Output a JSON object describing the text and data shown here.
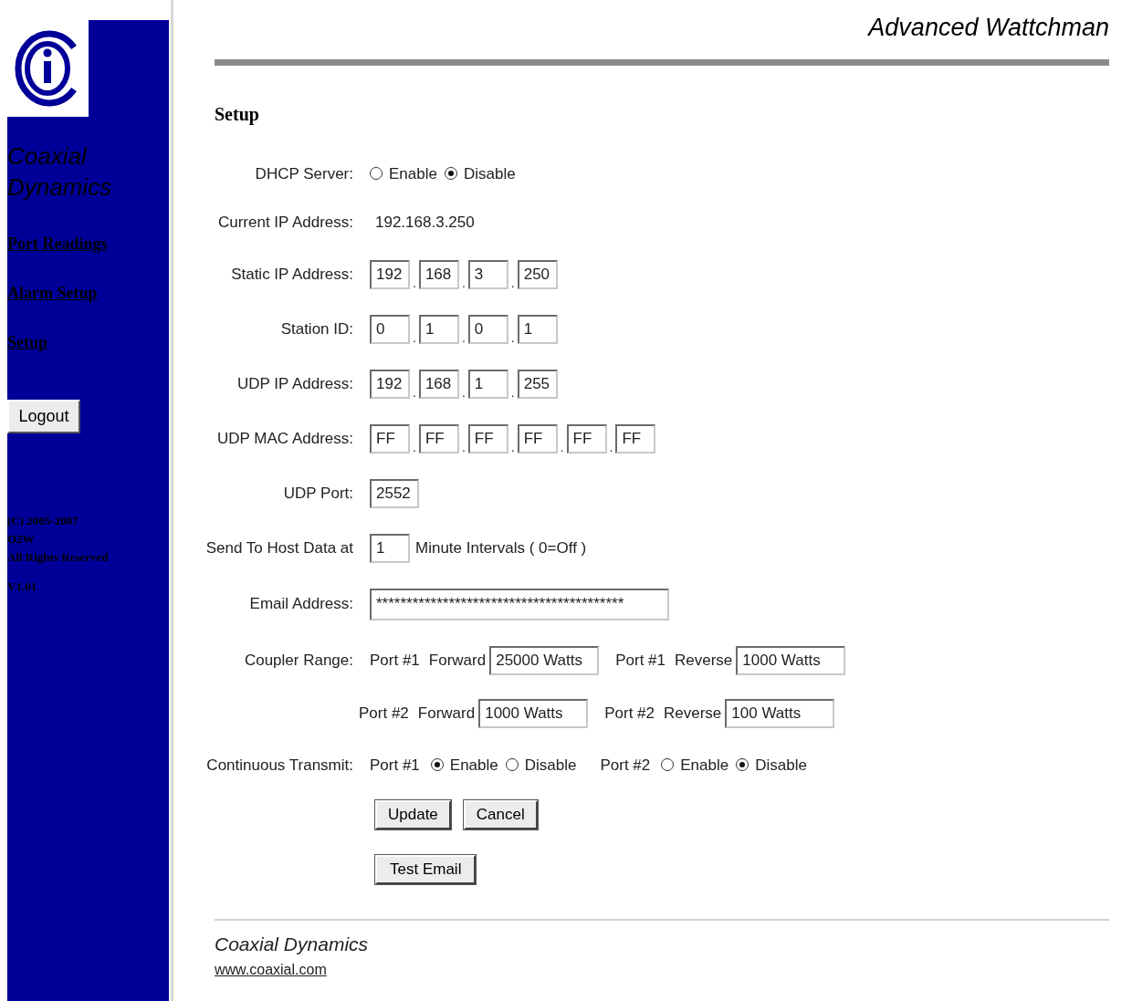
{
  "header": {
    "title": "Advanced Wattchman"
  },
  "sidebar": {
    "brand": "Coaxial Dynamics",
    "links": [
      "Port Readings",
      "Alarm Setup",
      "Setup"
    ],
    "logout": "Logout",
    "footer_lines": [
      "(C) 2005-2007",
      "O2W",
      "All Rights Reserved"
    ],
    "version": "V1.01"
  },
  "form": {
    "title": "Setup",
    "rows": [
      {
        "kind": "radio",
        "label": "DHCP Server:",
        "options": [
          {
            "label": "Enable",
            "selected": false
          },
          {
            "label": "Disable",
            "selected": true
          }
        ]
      },
      {
        "kind": "text",
        "label": "Current IP Address:",
        "value": "192.168.3.250"
      },
      {
        "kind": "octets",
        "label": "Static IP Address:",
        "separator": ".",
        "values": [
          "192",
          "168",
          "3",
          "250"
        ]
      },
      {
        "kind": "octets",
        "label": "Station ID:",
        "separator": ".",
        "values": [
          "0",
          "1",
          "0",
          "1"
        ]
      },
      {
        "kind": "octets",
        "label": "UDP IP Address:",
        "separator": ".",
        "values": [
          "192",
          "168",
          "1",
          "255"
        ]
      },
      {
        "kind": "octets",
        "label": "UDP MAC Address:",
        "separator": ".",
        "values": [
          "FF",
          "FF",
          "FF",
          "FF",
          "FF",
          "FF"
        ]
      },
      {
        "kind": "field",
        "label": "UDP Port:",
        "value": "2552"
      },
      {
        "kind": "interval",
        "label": "Send To Host Data at",
        "value": "1",
        "suffix": "Minute Intervals ( 0=Off )"
      },
      {
        "kind": "email",
        "label": "Email Address:",
        "value": "*****************************************"
      },
      {
        "kind": "coupler",
        "label": "Coupler Range:",
        "lines": [
          [
            {
              "port": "Port #1",
              "direction": "Forward",
              "value": "25000 Watts"
            },
            {
              "port": "Port #1",
              "direction": "Reverse",
              "value": "1000 Watts"
            }
          ],
          [
            {
              "port": "Port #2",
              "direction": "Forward",
              "value": "1000 Watts"
            },
            {
              "port": "Port #2",
              "direction": "Reverse",
              "value": "100 Watts"
            }
          ]
        ]
      },
      {
        "kind": "transmit",
        "label": "Continuous Transmit:",
        "groups": [
          {
            "port": "Port #1",
            "options": [
              {
                "label": "Enable",
                "selected": true
              },
              {
                "label": "Disable",
                "selected": false
              }
            ]
          },
          {
            "port": "Port #2",
            "options": [
              {
                "label": "Enable",
                "selected": false
              },
              {
                "label": "Disable",
                "selected": true
              }
            ]
          }
        ]
      }
    ],
    "buttons": [
      "Update",
      "Cancel"
    ],
    "test_button": "Test Email"
  },
  "footer": {
    "company": "Coaxial Dynamics",
    "url": "www.coaxial.com"
  }
}
